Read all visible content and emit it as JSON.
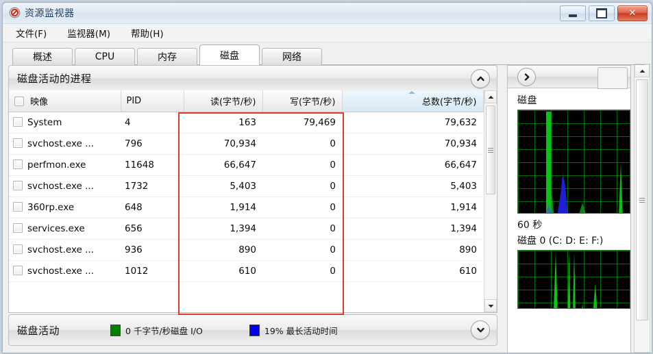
{
  "window": {
    "title": "资源监视器",
    "icon": "resource-monitor-icon",
    "buttons": {
      "minimize": "最小化",
      "maximize": "最大化",
      "close": "关闭"
    }
  },
  "menu": {
    "items": [
      "文件(F)",
      "监视器(M)",
      "帮助(H)"
    ]
  },
  "tabs": [
    {
      "label": "概述",
      "active": false
    },
    {
      "label": "CPU",
      "active": false
    },
    {
      "label": "内存",
      "active": false
    },
    {
      "label": "磁盘",
      "active": true
    },
    {
      "label": "网络",
      "active": false
    }
  ],
  "process_section": {
    "title": "磁盘活动的进程",
    "collapse_icon": "chevron-up-icon",
    "columns": [
      "映像",
      "PID",
      "读(字节/秒)",
      "写(字节/秒)",
      "总数(字节/秒)"
    ],
    "sorted_column": "总数(字节/秒)",
    "rows": [
      {
        "image": "System",
        "pid": "4",
        "read": "163",
        "write": "79,469",
        "total": "79,632"
      },
      {
        "image": "svchost.exe ...",
        "pid": "796",
        "read": "70,934",
        "write": "0",
        "total": "70,934"
      },
      {
        "image": "perfmon.exe",
        "pid": "11648",
        "read": "66,647",
        "write": "0",
        "total": "66,647"
      },
      {
        "image": "svchost.exe ...",
        "pid": "1732",
        "read": "5,403",
        "write": "0",
        "total": "5,403"
      },
      {
        "image": "360rp.exe",
        "pid": "648",
        "read": "1,914",
        "write": "0",
        "total": "1,914"
      },
      {
        "image": "services.exe",
        "pid": "656",
        "read": "1,394",
        "write": "0",
        "total": "1,394"
      },
      {
        "image": "svchost.exe ...",
        "pid": "936",
        "read": "890",
        "write": "0",
        "total": "890"
      },
      {
        "image": "svchost.exe ...",
        "pid": "1012",
        "read": "610",
        "write": "0",
        "total": "610"
      }
    ]
  },
  "disk_activity_bar": {
    "title": "磁盘活动",
    "expand_icon": "chevron-down-icon",
    "legend": [
      {
        "label": "0 千字节/秒磁盘 I/O",
        "color": "#008000"
      },
      {
        "label": "19% 最长活动时间",
        "color": "#0000ee"
      }
    ]
  },
  "right_panel": {
    "expand_icon": "chevron-right-icon",
    "graphs": [
      {
        "label": "磁盘",
        "time_axis": "60 秒"
      },
      {
        "label": "磁盘 0 (C: D: E: F:)",
        "time_axis": ""
      }
    ]
  },
  "annotation": {
    "type": "red-rectangle",
    "color": "#e23a30"
  },
  "scrollbars": {
    "table": {
      "up": "▲",
      "down": "▼"
    },
    "outer": {
      "up": "▲"
    }
  }
}
